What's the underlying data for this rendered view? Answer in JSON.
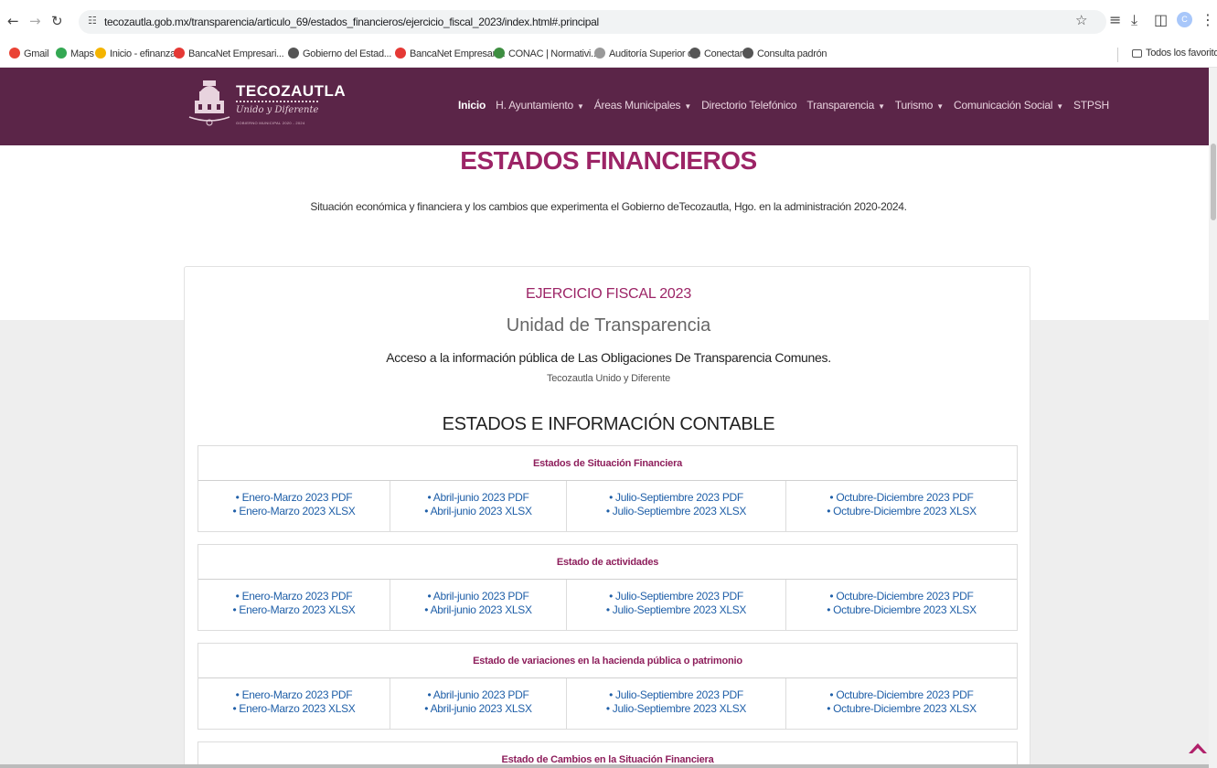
{
  "browser": {
    "url": "tecozautla.gob.mx/transparencia/articulo_69/estados_financieros/ejercicio_fiscal_2023/index.html#.principal",
    "profile_initial": "C",
    "bookmarks": [
      {
        "label": "Gmail",
        "color": "#ea4335"
      },
      {
        "label": "Maps",
        "color": "#34a853"
      },
      {
        "label": "Inicio - efinanzas",
        "color": "#f4b400"
      },
      {
        "label": "BancaNet Empresari...",
        "color": "#e53935"
      },
      {
        "label": "Gobierno del Estad...",
        "color": "#555555"
      },
      {
        "label": "BancaNet Empresari...",
        "color": "#e53935"
      },
      {
        "label": "CONAC | Normativi...",
        "color": "#3e8e41"
      },
      {
        "label": "Auditoría Superior d...",
        "color": "#999999"
      },
      {
        "label": "Conectar",
        "color": "#555555"
      },
      {
        "label": "Consulta padrón",
        "color": "#555555"
      }
    ],
    "all_bookmarks": "Todos los favoritos"
  },
  "header": {
    "logo_title": "TECOZAUTLA",
    "logo_sub": "Unido y Diferente",
    "logo_small": "GOBIERNO MUNICIPAL 2020 - 2024",
    "menu": [
      {
        "label": "Inicio",
        "dropdown": false,
        "active": true
      },
      {
        "label": "H. Ayuntamiento",
        "dropdown": true
      },
      {
        "label": "Áreas Municipales",
        "dropdown": true
      },
      {
        "label": "Directorio Telefónico",
        "dropdown": false
      },
      {
        "label": "Transparencia",
        "dropdown": true
      },
      {
        "label": "Turismo",
        "dropdown": true
      },
      {
        "label": "Comunicación Social",
        "dropdown": true
      },
      {
        "label": "STPSH",
        "dropdown": false
      }
    ]
  },
  "page": {
    "title": "ESTADOS FINANCIEROS",
    "description": "Situación económica y financiera y los cambios que experimenta el Gobierno deTecozautla, Hgo. en la administración 2020-2024.",
    "ejercicio": "EJERCICIO FISCAL 2023",
    "unidad": "Unidad de Transparencia",
    "acceso": "Acceso a la información pública de Las Obligaciones De Transparencia Comunes.",
    "lema": "Tecozautla Unido y Diferente",
    "section_title": "ESTADOS E INFORMACIÓN CONTABLE"
  },
  "tables": [
    {
      "title": "Estados de Situación Financiera",
      "cells": [
        [
          "• Enero-Marzo 2023 PDF",
          "• Enero-Marzo 2023 XLSX"
        ],
        [
          "• Abril-junio 2023 PDF",
          "• Abril-junio 2023 XLSX"
        ],
        [
          "• Julio-Septiembre 2023 PDF",
          "• Julio-Septiembre 2023 XLSX"
        ],
        [
          "• Octubre-Diciembre 2023 PDF",
          "• Octubre-Diciembre 2023 XLSX"
        ]
      ]
    },
    {
      "title": "Estado de actividades",
      "cells": [
        [
          "• Enero-Marzo 2023 PDF",
          "• Enero-Marzo 2023 XLSX"
        ],
        [
          "• Abril-junio 2023 PDF",
          "• Abril-junio 2023 XLSX"
        ],
        [
          "• Julio-Septiembre 2023 PDF",
          "• Julio-Septiembre 2023 XLSX"
        ],
        [
          "• Octubre-Diciembre 2023 PDF",
          "• Octubre-Diciembre 2023 XLSX"
        ]
      ]
    },
    {
      "title": "Estado de variaciones en la hacienda pública o patrimonio",
      "cells": [
        [
          "• Enero-Marzo 2023 PDF",
          "• Enero-Marzo 2023 XLSX"
        ],
        [
          "• Abril-junio 2023 PDF",
          "• Abril-junio 2023 XLSX"
        ],
        [
          "• Julio-Septiembre 2023 PDF",
          "• Julio-Septiembre 2023 XLSX"
        ],
        [
          "• Octubre-Diciembre 2023 PDF",
          "• Octubre-Diciembre 2023 XLSX"
        ]
      ]
    },
    {
      "title": "Estado de Cambios en la Situación Financiera",
      "cells": []
    }
  ],
  "colors": {
    "header_bg": "#5b2548",
    "accent": "#9c2466",
    "link": "#1f5fa8"
  }
}
